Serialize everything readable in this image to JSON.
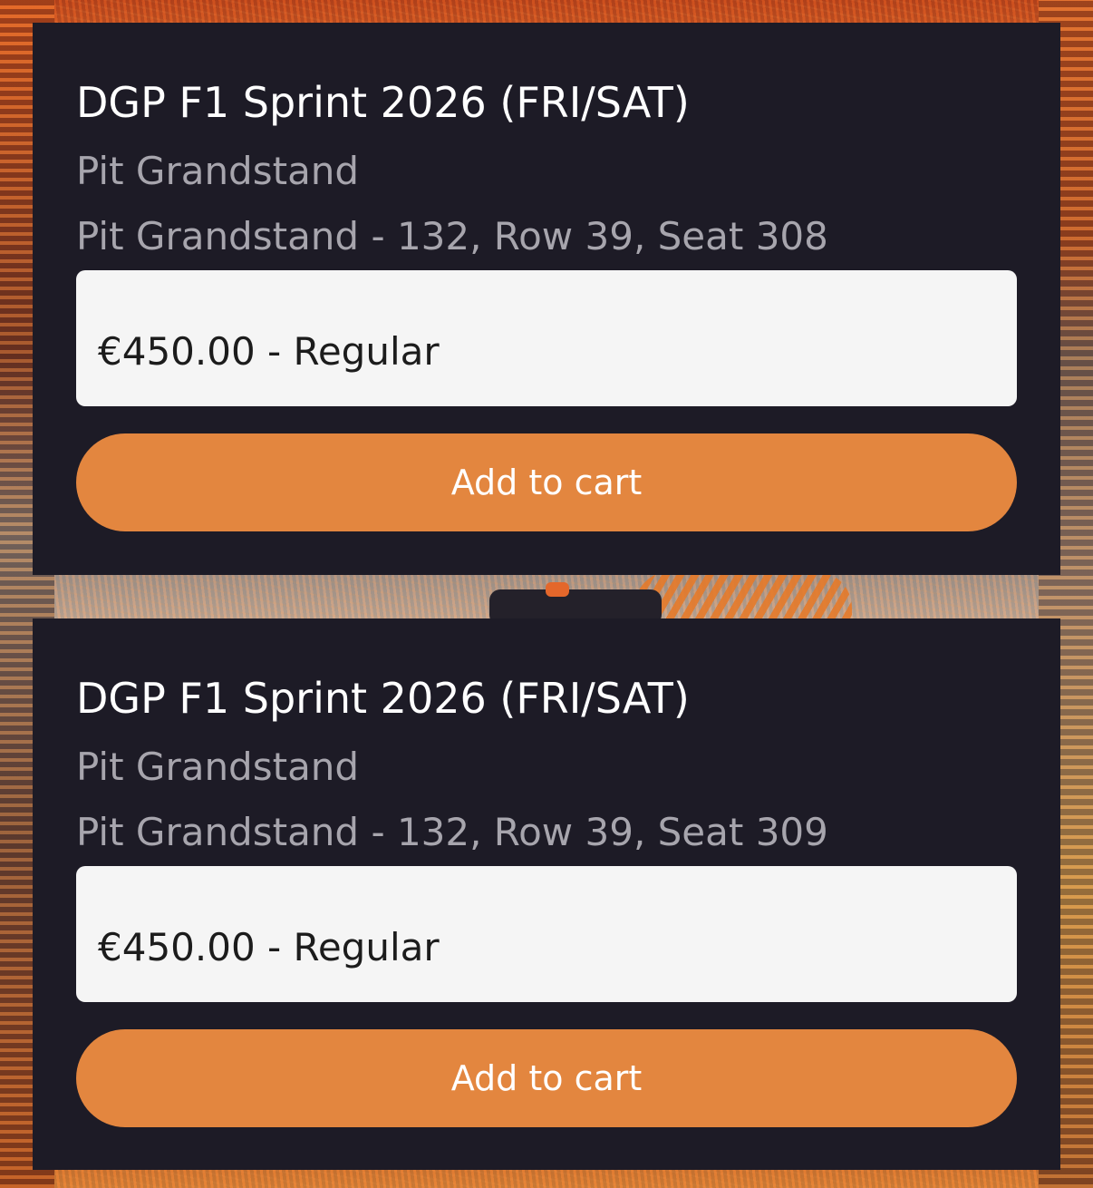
{
  "colors": {
    "card_background": "#1d1b26",
    "title_text": "#ffffff",
    "secondary_text": "#a7a5ad",
    "select_background": "#f5f5f5",
    "button_background": "#e3863f",
    "button_text": "#ffffff"
  },
  "tickets": [
    {
      "event": "DGP F1 Sprint 2026 (FRI/SAT)",
      "stand": "Pit Grandstand",
      "seat": "Pit Grandstand - 132, Row 39, Seat 308",
      "price_option": "€450.00 - Regular",
      "button_label": "Add to cart"
    },
    {
      "event": "DGP F1 Sprint 2026 (FRI/SAT)",
      "stand": "Pit Grandstand",
      "seat": "Pit Grandstand - 132, Row 39, Seat 309",
      "price_option": "€450.00 - Regular",
      "button_label": "Add to cart"
    }
  ]
}
